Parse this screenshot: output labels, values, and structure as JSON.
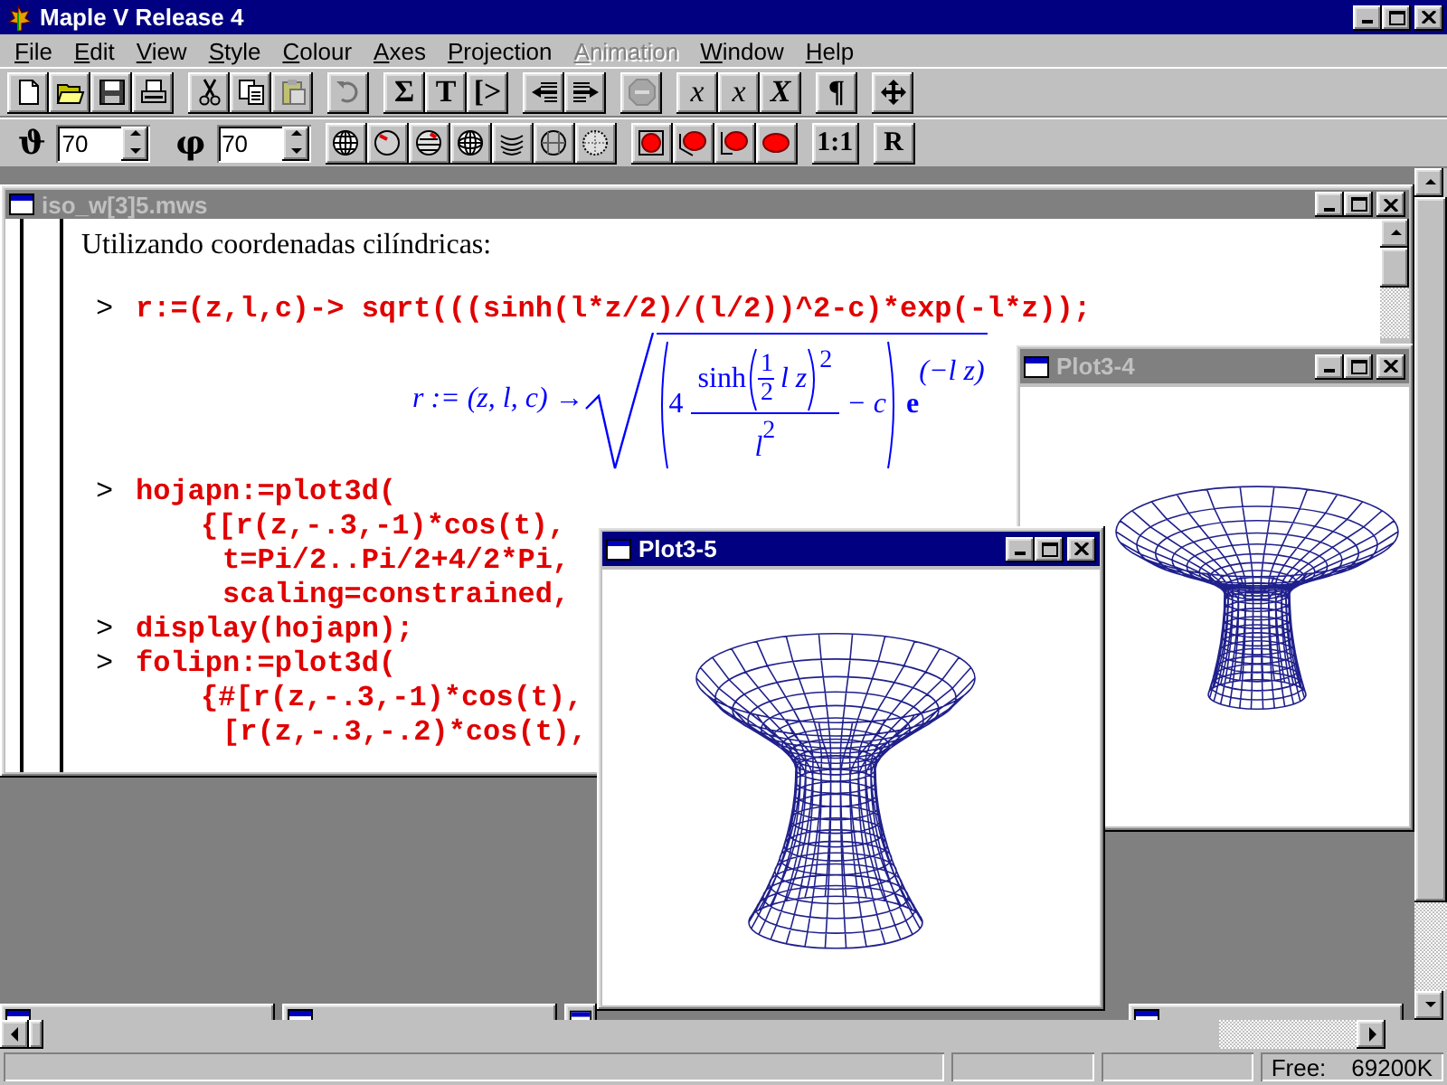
{
  "window": {
    "title": "Maple V Release 4"
  },
  "menu": [
    {
      "label": "File",
      "disabled": false
    },
    {
      "label": "Edit",
      "disabled": false
    },
    {
      "label": "View",
      "disabled": false
    },
    {
      "label": "Style",
      "disabled": false
    },
    {
      "label": "Colour",
      "disabled": false
    },
    {
      "label": "Axes",
      "disabled": false
    },
    {
      "label": "Projection",
      "disabled": false
    },
    {
      "label": "Animation",
      "disabled": true
    },
    {
      "label": "Window",
      "disabled": false
    },
    {
      "label": "Help",
      "disabled": false
    }
  ],
  "toolbar": [
    [
      {
        "kind": "icon",
        "disabled": false
      },
      {
        "kind": "icon",
        "disabled": false
      },
      {
        "kind": "icon",
        "disabled": false
      },
      {
        "kind": "icon",
        "disabled": false
      }
    ],
    [
      {
        "kind": "icon",
        "disabled": false
      },
      {
        "kind": "icon",
        "disabled": false
      },
      {
        "kind": "icon",
        "disabled": true
      }
    ],
    [
      {
        "kind": "icon",
        "disabled": true
      }
    ],
    [
      {
        "kind": "glyph",
        "label": "Σ",
        "bold": true,
        "disabled": false
      },
      {
        "kind": "glyph",
        "label": "T",
        "bold": true,
        "disabled": false
      },
      {
        "kind": "glyph",
        "label": "[>",
        "bold": true,
        "disabled": false
      }
    ],
    [
      {
        "kind": "icon",
        "disabled": false
      },
      {
        "kind": "icon",
        "disabled": false
      }
    ],
    [
      {
        "kind": "icon",
        "disabled": true
      }
    ],
    [
      {
        "kind": "glyph",
        "label": "x",
        "bold": false,
        "disabled": false
      },
      {
        "kind": "glyph",
        "label": "x",
        "bold": false,
        "disabled": false
      },
      {
        "kind": "glyph",
        "label": "X",
        "bold": true,
        "disabled": false
      }
    ],
    [
      {
        "kind": "glyph",
        "label": "¶",
        "bold": true,
        "disabled": false
      }
    ],
    [
      {
        "kind": "icon",
        "disabled": false
      }
    ]
  ],
  "view_toolbar": {
    "theta": {
      "symbol": "ϑ",
      "value": "70"
    },
    "phi": {
      "symbol": "φ",
      "value": "70"
    },
    "buttons": [
      {
        "label": "1:1"
      },
      {
        "label": "R"
      }
    ]
  },
  "worksheet": {
    "title": "iso_w[3]5.mws",
    "active": false,
    "text": "Utilizando coordenadas cilíndricas:",
    "command": {
      "prompt": ">",
      "code": "r:=(z,l,c)-> sqrt(((sinh(l*z/2)/(l/2))^2-c)*exp(-l*z));"
    },
    "result": {
      "lhs": "r := (z, l, c) →",
      "coefficient": "4",
      "function": "sinh",
      "half_numerator": "1",
      "half_denominator": "2",
      "argument": "l z",
      "power": "2",
      "denominator": "l",
      "denominator_power": "2",
      "minus": "− c",
      "base": "e",
      "exponent": "(−l z)"
    },
    "commands": [
      {
        "prompt": ">",
        "code": "hojapn:=plot3d(",
        "children": [
          {
            "code": "{[r(z,-.3,-1)*cos(t),",
            "children": [
              {
                "code": "t=Pi/2..Pi/2+4/2*Pi,"
              },
              {
                "code": "scaling=constrained,"
              }
            ]
          }
        ]
      },
      {
        "prompt": ">",
        "code": "display(hojapn);"
      },
      {
        "prompt": ">",
        "code": "folipn:=plot3d(",
        "children": [
          {
            "code": "{#[r(z,-.3,-1)*cos(t),",
            "children": [
              {
                "code": "[r(z,-.3,-.2)*cos(t),"
              }
            ]
          }
        ]
      }
    ]
  },
  "plots": [
    {
      "title": "Plot3-4",
      "active": false
    },
    {
      "title": "Plot3-5",
      "active": true
    }
  ],
  "status_bar": {
    "memory_label": "Free:",
    "memory_value": "69200K"
  }
}
